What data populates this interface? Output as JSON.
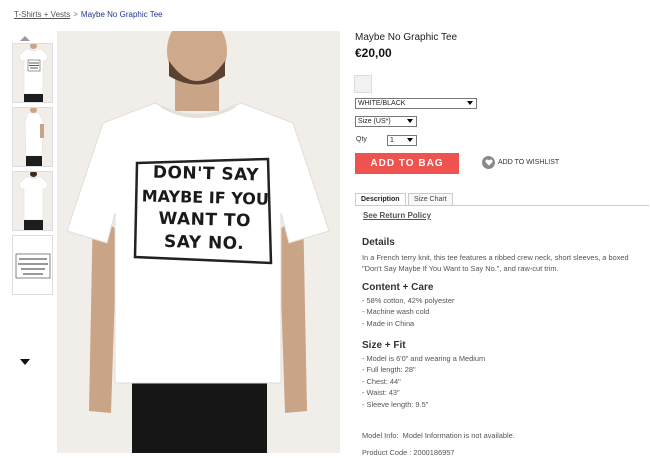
{
  "breadcrumb": {
    "category": "T-Shirts + Vests",
    "separator": ">",
    "current": "Maybe No Graphic Tee"
  },
  "gallery": {
    "up_icon": "chevron-up-icon",
    "down_icon": "chevron-down-icon",
    "main_shirt_text": [
      "DON'T SAY",
      "MAYBE IF YOU",
      "WANT TO",
      "SAY NO."
    ],
    "thumbnail_count": 4
  },
  "product": {
    "title": "Maybe No Graphic Tee",
    "price": "€20,00",
    "color_select": "WHITE/BLACK",
    "size_select": "Size (US*)",
    "qty_label": "Qty",
    "qty_value": "1",
    "add_to_bag": "ADD TO BAG",
    "wishlist": "ADD TO WISHLIST",
    "wishlist_icon": "heart-icon"
  },
  "tabs": {
    "description": "Description",
    "size_chart": "Size Chart"
  },
  "description": {
    "return_policy": "See Return Policy",
    "details_heading": "Details",
    "details_text": "In a French terry knit, this tee features a ribbed crew neck, short sleeves, a boxed \"Don't Say Maybe If You Want to Say No.\", and raw-cut trim.",
    "care_heading": "Content + Care",
    "care_items": [
      "- 58% cotton, 42% polyester",
      "- Machine wash cold",
      "- Made in China"
    ],
    "fit_heading": "Size + Fit",
    "fit_items": [
      "- Model is 6'0\" and wearing a Medium",
      "- Full length: 28\"",
      "- Chest: 44\"",
      "- Waist: 43\"",
      "- Sleeve length: 9.5\""
    ],
    "model_info": "Model Info:  Model Information is not available.",
    "product_code": "Product Code : 2000186957"
  },
  "colors": {
    "accent_button": "#ef5350",
    "breadcrumb_current": "#1e3a8a",
    "image_background": "#f1eeea"
  }
}
